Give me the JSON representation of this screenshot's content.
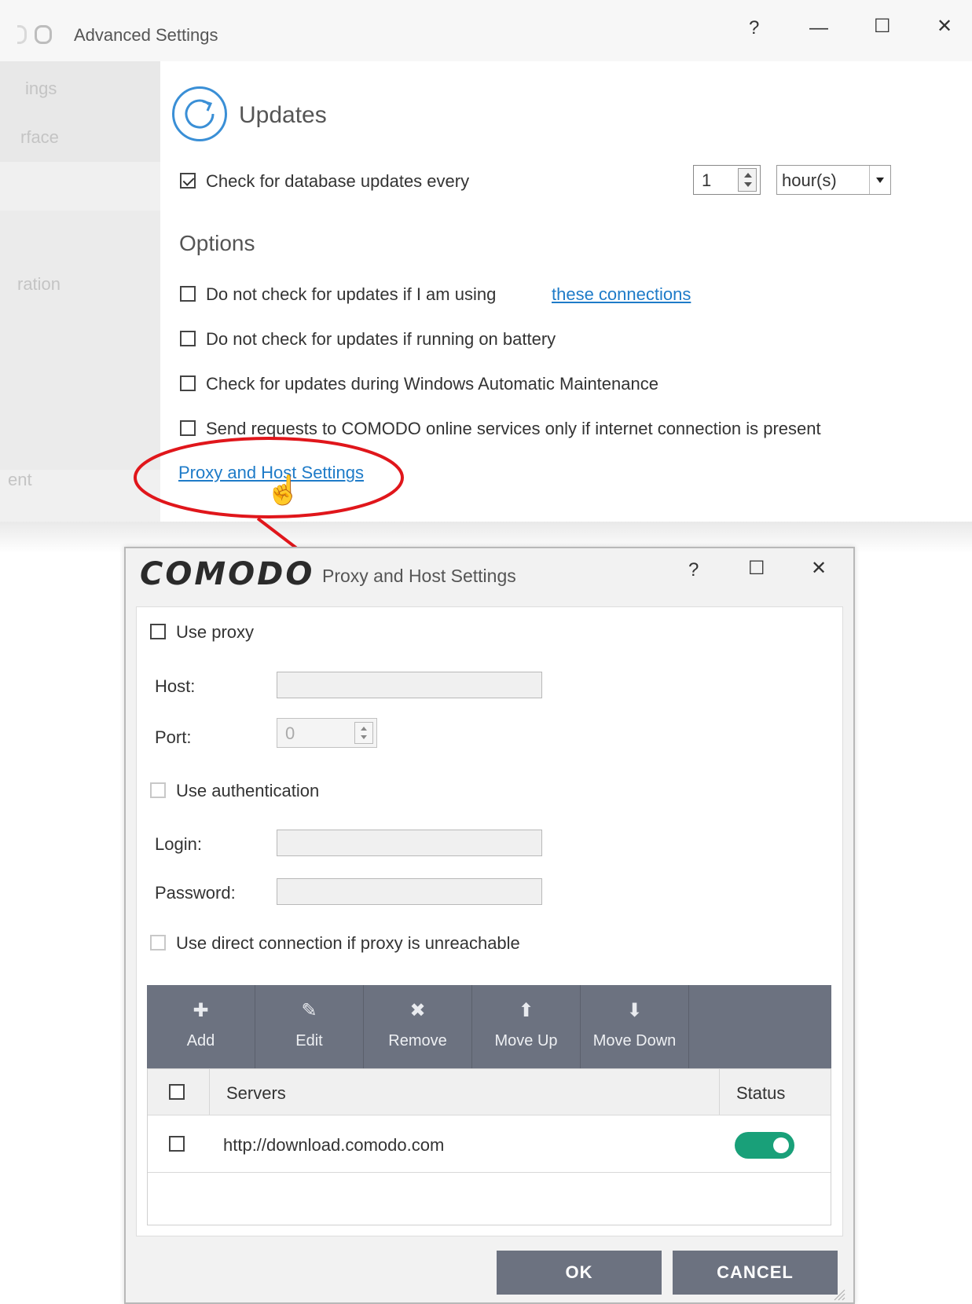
{
  "advanced_window": {
    "title": "Advanced Settings",
    "controls": {
      "help": "?",
      "minimize": "—",
      "maximize": "☐",
      "close": "✕"
    },
    "nav_fragments": [
      "ings",
      "rface",
      "ration",
      "ent"
    ],
    "section_title": "Updates",
    "check_updates": {
      "label": "Check for database updates every",
      "checked": true,
      "interval": "1",
      "unit": "hour(s)"
    },
    "options_title": "Options",
    "options": [
      {
        "label": "Do not check for updates if I am using",
        "link": "these connections",
        "checked": false
      },
      {
        "label": "Do not check for updates if running on battery",
        "checked": false
      },
      {
        "label": "Check for updates during Windows Automatic Maintenance",
        "checked": false
      },
      {
        "label": "Send requests to COMODO online services only if internet connection is present",
        "checked": false
      }
    ],
    "proxy_link": "Proxy and Host Settings"
  },
  "proxy_dialog": {
    "brand": "COMODO",
    "title": "Proxy and Host Settings",
    "controls": {
      "help": "?",
      "maximize": "☐",
      "close": "✕"
    },
    "use_proxy": "Use proxy",
    "host_label": "Host:",
    "port_label": "Port:",
    "port_value": "0",
    "use_auth": "Use authentication",
    "login_label": "Login:",
    "password_label": "Password:",
    "direct_connection": "Use direct connection if proxy is unreachable",
    "toolbar": [
      {
        "label": "Add",
        "icon": "✚"
      },
      {
        "label": "Edit",
        "icon": "✎"
      },
      {
        "label": "Remove",
        "icon": "✖"
      },
      {
        "label": "Move Up",
        "icon": "⬆"
      },
      {
        "label": "Move Down",
        "icon": "⬇"
      }
    ],
    "table": {
      "headers": {
        "servers": "Servers",
        "status": "Status"
      },
      "rows": [
        {
          "server": "http://download.comodo.com",
          "enabled": true
        }
      ]
    },
    "ok": "OK",
    "cancel": "CANCEL"
  },
  "colors": {
    "accent": "#1e7bc8",
    "annotation": "#e0161b",
    "toolbar": "#6c7280",
    "toggle_on": "#19a079"
  }
}
